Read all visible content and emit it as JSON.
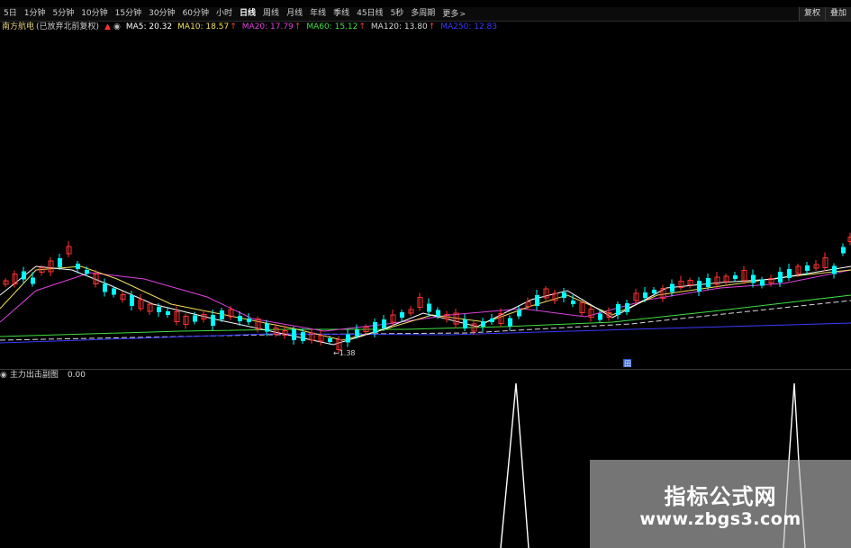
{
  "toolbar": {
    "periods": [
      {
        "label": "5日",
        "active": false
      },
      {
        "label": "1分钟",
        "active": false
      },
      {
        "label": "5分钟",
        "active": false
      },
      {
        "label": "10分钟",
        "active": false
      },
      {
        "label": "15分钟",
        "active": false
      },
      {
        "label": "30分钟",
        "active": false
      },
      {
        "label": "60分钟",
        "active": false
      },
      {
        "label": "小时",
        "active": false
      },
      {
        "label": "日线",
        "active": true
      },
      {
        "label": "周线",
        "active": false
      },
      {
        "label": "月线",
        "active": false
      },
      {
        "label": "年线",
        "active": false
      },
      {
        "label": "季线",
        "active": false
      },
      {
        "label": "45日线",
        "active": false
      },
      {
        "label": "5秒",
        "active": false
      },
      {
        "label": "多周期",
        "active": false
      },
      {
        "label": "更多",
        "active": false
      }
    ],
    "more_chevron": ">",
    "right_buttons": [
      "复权",
      "叠加"
    ]
  },
  "legend": {
    "stock_name": "南方航电",
    "sub_tag": "(已放弃北前复权)",
    "ma": [
      {
        "label": "MA5: 20.32",
        "color": "#ffffff",
        "up": false
      },
      {
        "label": "MA10: 18.57",
        "color": "#f0e05a",
        "up": true
      },
      {
        "label": "MA20: 17.79",
        "color": "#e040e0",
        "up": true
      },
      {
        "label": "MA60: 15.12",
        "color": "#40e040",
        "up": true
      },
      {
        "label": "MA120: 13.80",
        "color": "#d8d8d8",
        "up": true
      },
      {
        "label": "MA250: 12.83",
        "color": "#3a3aff",
        "up": false
      }
    ],
    "up_arrow": "↑"
  },
  "chart": {
    "low_marker": "←1.38",
    "bottom_badge": "田"
  },
  "indicator": {
    "title": "主力出击副图",
    "value": "0.00"
  },
  "watermark": {
    "title": "指标公式网",
    "url": "www.zbgs3.com"
  },
  "colors": {
    "up_candle": "#ff3232",
    "down_candle": "#00ffff",
    "ma5": "#ffffff",
    "ma10": "#f0e05a",
    "ma20": "#e040e0",
    "ma60": "#40e040",
    "ma120": "#d8d8d8",
    "ma250": "#3a3aff",
    "indicator_line": "#ffffff"
  }
}
